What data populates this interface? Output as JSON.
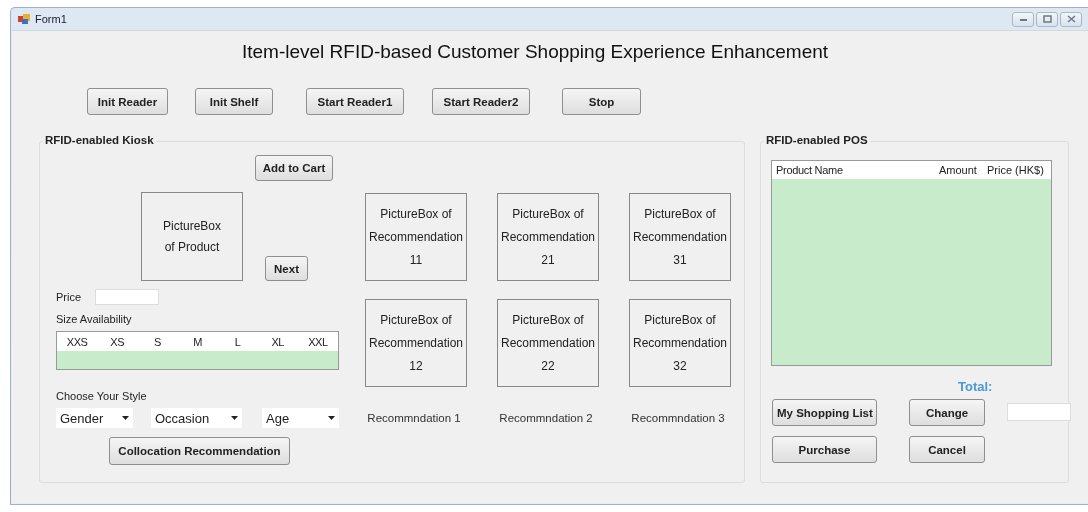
{
  "window": {
    "title": "Form1"
  },
  "heading": "Item-level RFID-based Customer Shopping Experience Enhancement",
  "toolbar": [
    "Init Reader",
    "Init Shelf",
    "Start Reader1",
    "Start Reader2",
    "Stop"
  ],
  "kiosk": {
    "title": "RFID-enabled Kiosk",
    "add_to_cart": "Add to Cart",
    "product_picture": [
      "PictureBox",
      "of Product"
    ],
    "next": "Next",
    "price_label": "Price",
    "size_label": "Size Availability",
    "sizes": [
      "XXS",
      "XS",
      "S",
      "M",
      "L",
      "XL",
      "XXL"
    ],
    "style_label": "Choose Your Style",
    "dropdowns": [
      {
        "value": "Gender"
      },
      {
        "value": "Occasion"
      },
      {
        "value": "Age"
      }
    ],
    "collocation_button": "Collocation Recommendation",
    "recommendation_boxes": [
      {
        "lines": [
          "PictureBox of",
          "Recommendation",
          "11"
        ]
      },
      {
        "lines": [
          "PictureBox of",
          "Recommendation",
          "21"
        ]
      },
      {
        "lines": [
          "PictureBox of",
          "Recommendation",
          "31"
        ]
      },
      {
        "lines": [
          "PictureBox of",
          "Recommendation",
          "12"
        ]
      },
      {
        "lines": [
          "PictureBox of",
          "Recommendation",
          "22"
        ]
      },
      {
        "lines": [
          "PictureBox of",
          "Recommendation",
          "32"
        ]
      }
    ],
    "recommendation_captions": [
      "Recommndation 1",
      "Recommndation 2",
      "Recommndation 3"
    ]
  },
  "pos": {
    "title": "RFID-enabled POS",
    "columns": [
      "Product Name",
      "Amount",
      "Price (HK$)"
    ],
    "total_label": "Total:",
    "buttons": [
      "My Shopping List",
      "Change",
      "Purchase",
      "Cancel"
    ]
  }
}
